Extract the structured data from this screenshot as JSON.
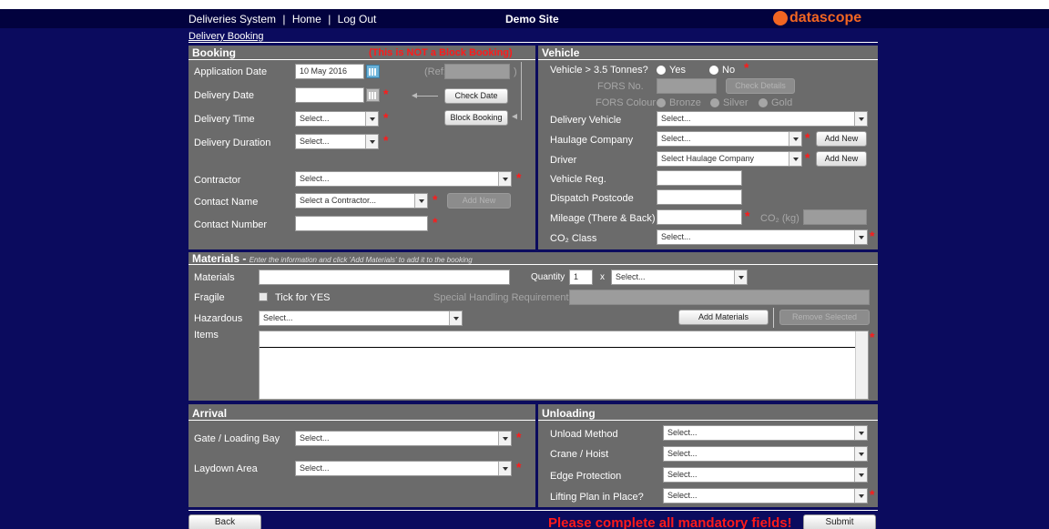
{
  "nav": {
    "app_title": "Deliveries System",
    "sep1": "|",
    "home": "Home",
    "sep2": "|",
    "logout": "Log Out",
    "site": "Demo Site",
    "brand": "datascope",
    "breadcrumb": "Delivery Booking"
  },
  "booking": {
    "title": "Booking",
    "notice": "(This is NOT a Block Booking)",
    "application_date_label": "Application Date",
    "application_date_value": "10 May 2016",
    "ref_label": "(Ref:",
    "ref_close": ")",
    "delivery_date_label": "Delivery Date",
    "check_date": "Check Date",
    "delivery_time_label": "Delivery Time",
    "delivery_time_value": "Select...",
    "block_booking": "Block Booking",
    "delivery_duration_label": "Delivery Duration",
    "delivery_duration_value": "Select...",
    "contractor_label": "Contractor",
    "contractor_value": "Select...",
    "contact_name_label": "Contact Name",
    "contact_name_value": "Select a Contractor...",
    "add_new": "Add New",
    "contact_number_label": "Contact Number"
  },
  "vehicle": {
    "title": "Vehicle",
    "over35_label": "Vehicle > 3.5 Tonnes?",
    "yes": "Yes",
    "no": "No",
    "fors_no_label": "FORS No.",
    "check_details": "Check Details",
    "fors_colour_label": "FORS Colour",
    "bronze": "Bronze",
    "silver": "Silver",
    "gold": "Gold",
    "delivery_vehicle_label": "Delivery Vehicle",
    "delivery_vehicle_value": "Select...",
    "haulage_label": "Haulage Company",
    "haulage_value": "Select...",
    "add_new": "Add New",
    "driver_label": "Driver",
    "driver_value": "Select Haulage Company",
    "reg_label": "Vehicle Reg.",
    "postcode_label": "Dispatch Postcode",
    "mileage_label": "Mileage (There & Back)",
    "co2kg_label": "CO₂ (kg)",
    "co2class_label": "CO₂ Class",
    "co2class_value": "Select..."
  },
  "materials": {
    "title": "Materials -",
    "hint": "Enter the information and click 'Add Materials' to add it to the booking",
    "materials_label": "Materials",
    "quantity_label": "Quantity",
    "quantity_value": "1",
    "x": "x",
    "unit_value": "Select...",
    "fragile_label": "Fragile",
    "tick_label": "Tick for YES",
    "special_label": "Special Handling Requirements",
    "hazardous_label": "Hazardous",
    "hazardous_value": "Select...",
    "add_materials": "Add Materials",
    "remove_selected": "Remove Selected",
    "items_label": "Items"
  },
  "arrival": {
    "title": "Arrival",
    "gate_label": "Gate / Loading Bay",
    "gate_value": "Select...",
    "laydown_label": "Laydown Area",
    "laydown_value": "Select..."
  },
  "unloading": {
    "title": "Unloading",
    "method_label": "Unload Method",
    "method_value": "Select...",
    "crane_label": "Crane / Hoist",
    "crane_value": "Select...",
    "edge_label": "Edge Protection",
    "edge_value": "Select...",
    "lifting_label": "Lifting Plan in Place?",
    "lifting_value": "Select..."
  },
  "footer": {
    "back": "Back",
    "warning": "Please complete all mandatory fields!",
    "submit": "Submit"
  },
  "colors": {
    "background": "#0b0b5e",
    "panel": "#6b6b6b",
    "required": "#ff1a1a",
    "brand": "#f26522"
  }
}
